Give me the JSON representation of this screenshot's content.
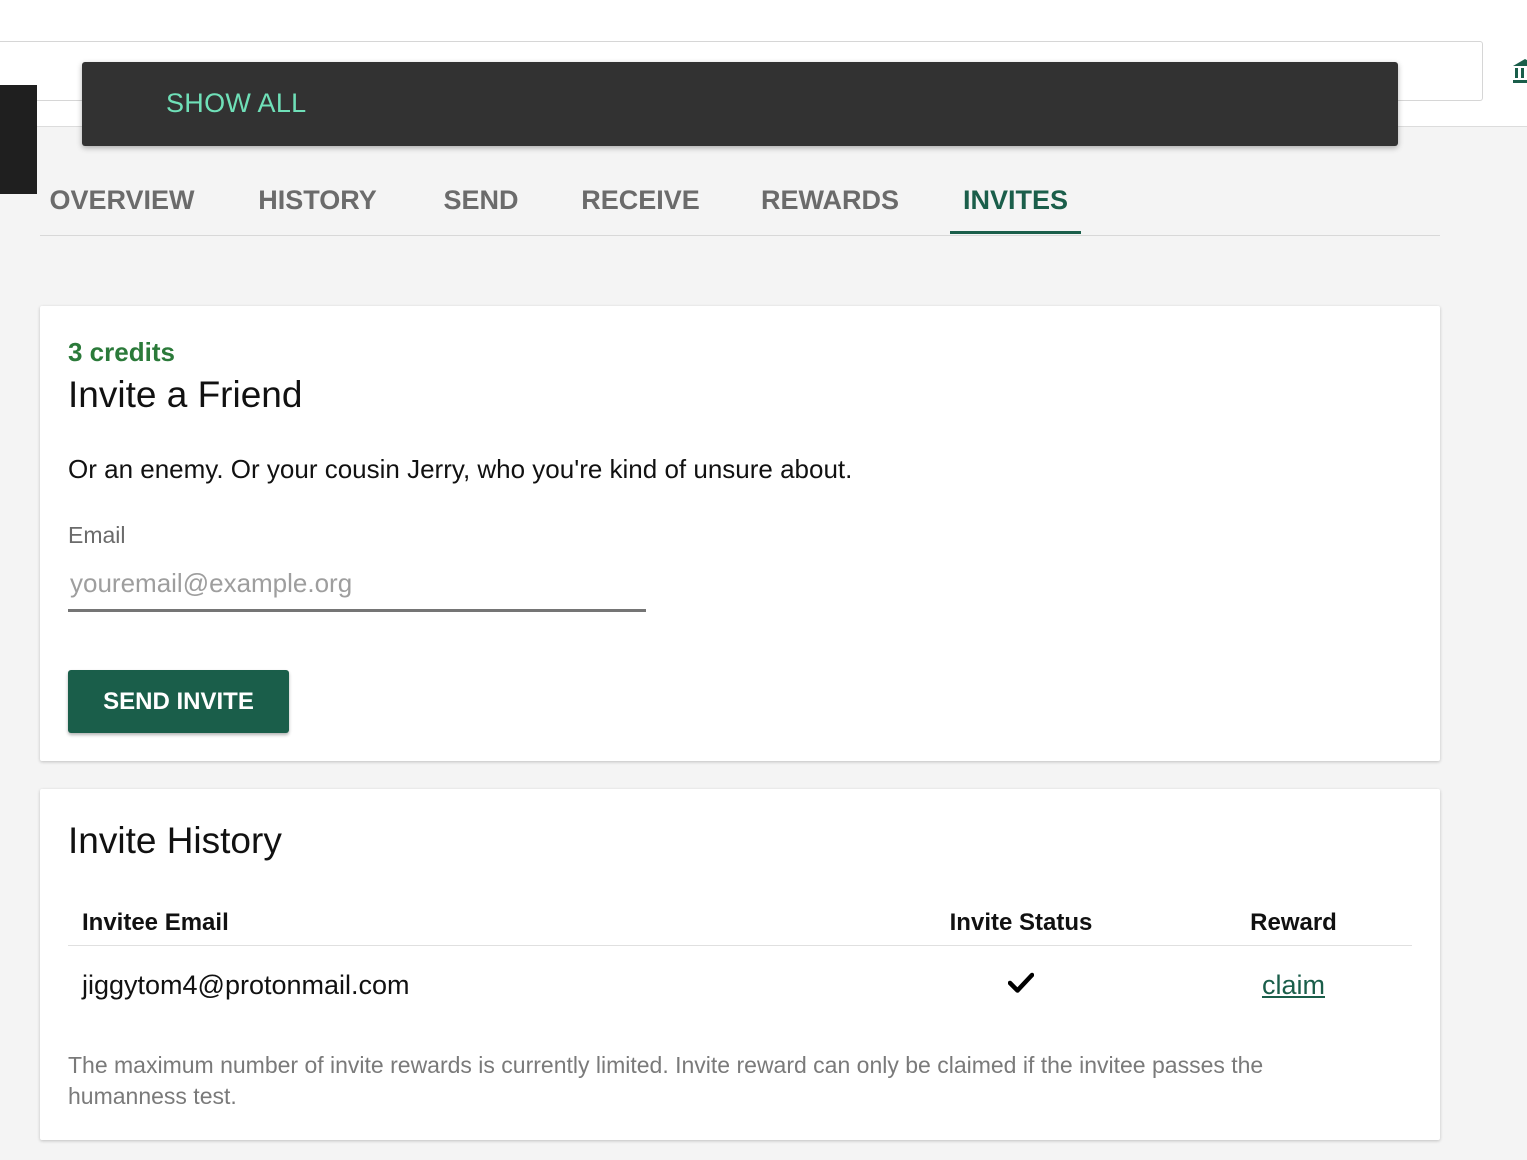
{
  "toast": {
    "action_label": "SHOW ALL"
  },
  "tabs": [
    {
      "label": "OVERVIEW"
    },
    {
      "label": "HISTORY"
    },
    {
      "label": "SEND"
    },
    {
      "label": "RECEIVE"
    },
    {
      "label": "REWARDS"
    },
    {
      "label": "INVITES",
      "active": true
    }
  ],
  "invite_card": {
    "credits": "3 credits",
    "title": "Invite a Friend",
    "description": "Or an enemy. Or your cousin Jerry, who you're kind of unsure about.",
    "email_label": "Email",
    "email_placeholder": "youremail@example.org",
    "email_value": "",
    "send_button": "SEND INVITE"
  },
  "history_card": {
    "title": "Invite History",
    "columns": [
      "Invitee Email",
      "Invite Status",
      "Reward"
    ],
    "rows": [
      {
        "email": "jiggytom4@protonmail.com",
        "status_icon": "checkmark-icon",
        "reward": "claim"
      }
    ],
    "note": "The maximum number of invite rewards is currently limited. Invite reward can only be claimed if the invitee passes the humanness test."
  },
  "colors": {
    "accent": "#1a5e4a",
    "credits": "#2b7a3a",
    "toast_bg": "#323232",
    "toast_action": "#6fe0b8"
  }
}
